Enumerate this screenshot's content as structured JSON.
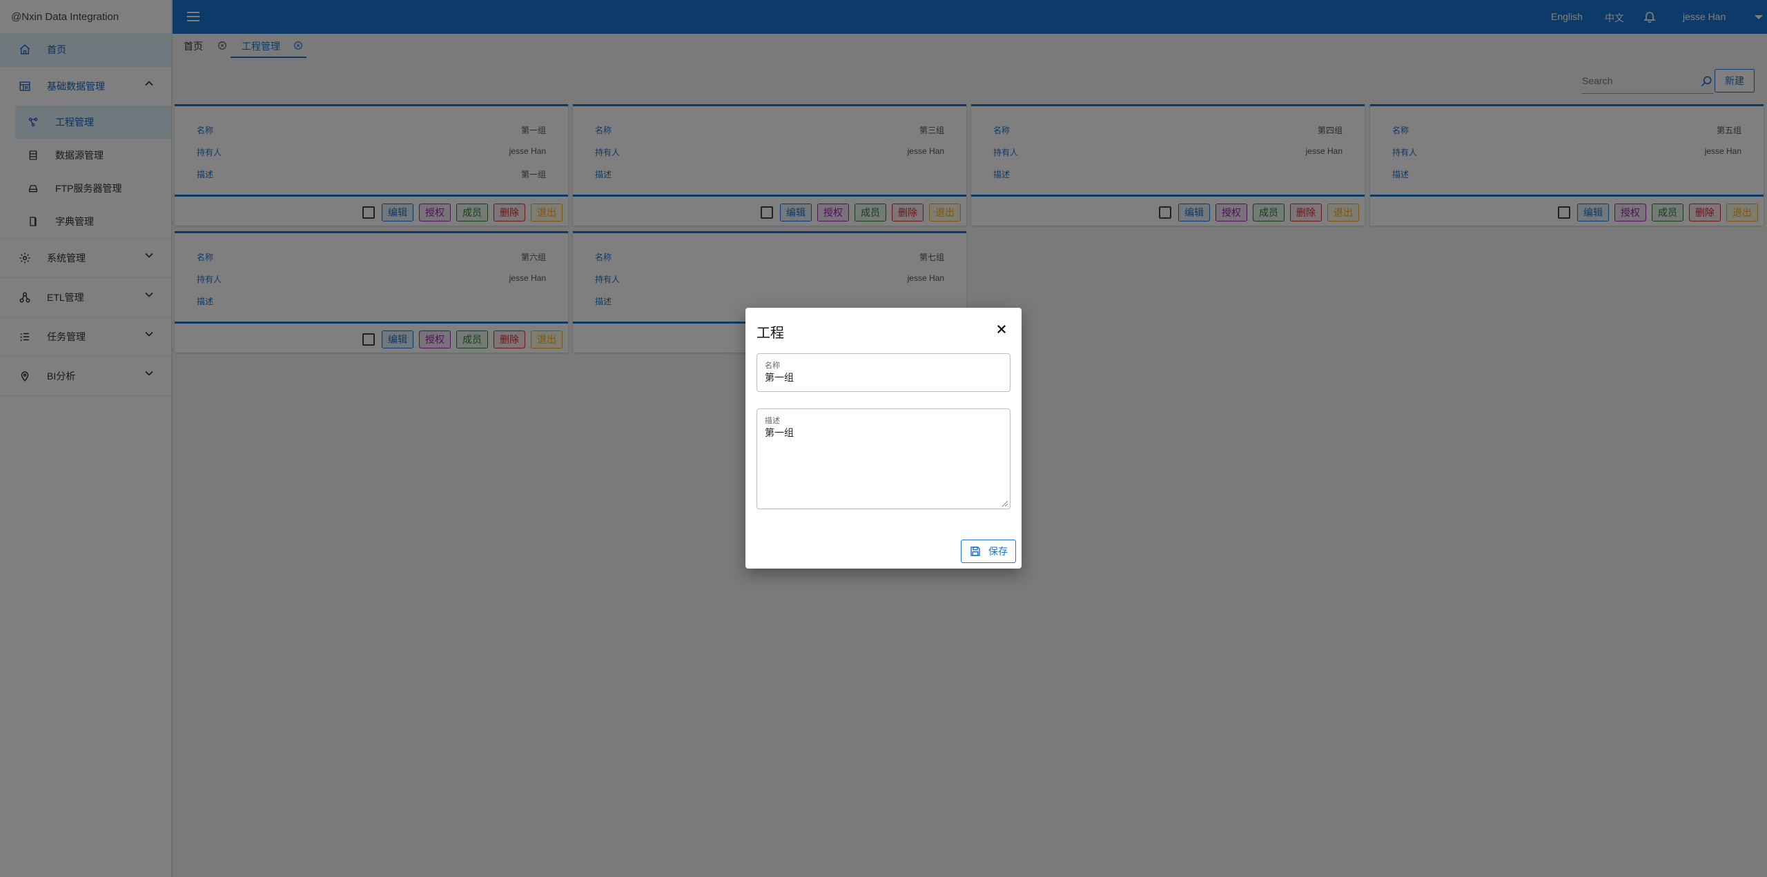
{
  "app": {
    "brand": "@Nxin Data Integration"
  },
  "sidebar": {
    "home": "首页",
    "basic_group": "基础数据管理",
    "basic_items": [
      "工程管理",
      "数据源管理",
      "FTP服务器管理",
      "字典管理"
    ],
    "system": "系统管理",
    "etl": "ETL管理",
    "task": "任务管理",
    "bi": "BI分析"
  },
  "header": {
    "lang_en": "English",
    "lang_zh": "中文",
    "user": "jesse Han"
  },
  "tabs": {
    "home": "首页",
    "project": "工程管理"
  },
  "toolbar": {
    "search_placeholder": "Search",
    "new_label": "新建"
  },
  "card_labels": {
    "name": "名称",
    "owner": "持有人",
    "desc": "描述"
  },
  "card_actions": {
    "edit": "编辑",
    "auth": "授权",
    "members": "成员",
    "delete": "删除",
    "exit": "退出"
  },
  "cards": [
    {
      "name": "第一组",
      "owner": "jesse Han",
      "desc": "第一组"
    },
    {
      "name": "第三组",
      "owner": "jesse Han",
      "desc": ""
    },
    {
      "name": "第四组",
      "owner": "jesse Han",
      "desc": ""
    },
    {
      "name": "第五组",
      "owner": "jesse Han",
      "desc": ""
    },
    {
      "name": "第六组",
      "owner": "jesse Han",
      "desc": ""
    },
    {
      "name": "第七组",
      "owner": "jesse Han",
      "desc": ""
    }
  ],
  "dialog": {
    "title": "工程",
    "name_label": "名称",
    "name_value": "第一组",
    "desc_label": "描述",
    "desc_value": "第一组",
    "save_label": "保存"
  },
  "colors": {
    "primary": "#1976d2",
    "active_bg": "#dff0fb"
  }
}
